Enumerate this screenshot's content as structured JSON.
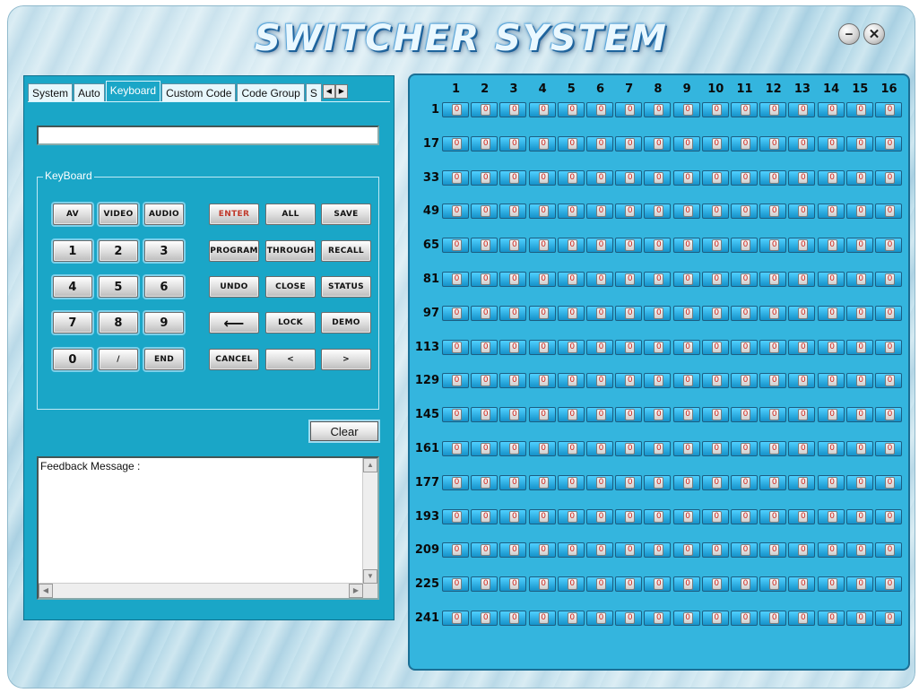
{
  "window": {
    "title": "SWITCHER SYSTEM",
    "minimize_label": "−",
    "close_label": "✕"
  },
  "tabs": [
    {
      "label": "System",
      "active": false
    },
    {
      "label": "Auto",
      "active": false
    },
    {
      "label": "Keyboard",
      "active": true
    },
    {
      "label": "Custom Code",
      "active": false
    },
    {
      "label": "Code Group",
      "active": false
    },
    {
      "label": "S",
      "active": false
    }
  ],
  "tab_scroll": {
    "left": "◀",
    "right": "▶"
  },
  "command_input": {
    "value": ""
  },
  "keyboard": {
    "legend": "KeyBoard",
    "rows": [
      [
        "AV",
        "VIDEO",
        "AUDIO",
        "ENTER",
        "ALL",
        "SAVE"
      ],
      [
        "1",
        "2",
        "3",
        "PROGRAM",
        "THROUGH",
        "RECALL"
      ],
      [
        "4",
        "5",
        "6",
        "UNDO",
        "CLOSE",
        "STATUS"
      ],
      [
        "7",
        "8",
        "9",
        "⟵",
        "LOCK",
        "DEMO"
      ],
      [
        "0",
        "/",
        "END",
        "CANCEL",
        "<",
        ">"
      ]
    ]
  },
  "clear_label": "Clear",
  "feedback": {
    "label": "Feedback Message :"
  },
  "scroll_glyphs": {
    "up": "▲",
    "down": "▼",
    "left": "◀",
    "right": "▶"
  },
  "matrix": {
    "columns": [
      "1",
      "2",
      "3",
      "4",
      "5",
      "6",
      "7",
      "8",
      "9",
      "10",
      "11",
      "12",
      "13",
      "14",
      "15",
      "16"
    ],
    "rows": [
      "1",
      "17",
      "33",
      "49",
      "65",
      "81",
      "97",
      "113",
      "129",
      "145",
      "161",
      "177",
      "193",
      "209",
      "225",
      "241"
    ],
    "cell_value": "0"
  },
  "colors": {
    "panel_left": "#1aa6c7",
    "panel_right": "#34b5de",
    "cell_value_text": "#d0261c",
    "enter_text": "#c0392b"
  }
}
